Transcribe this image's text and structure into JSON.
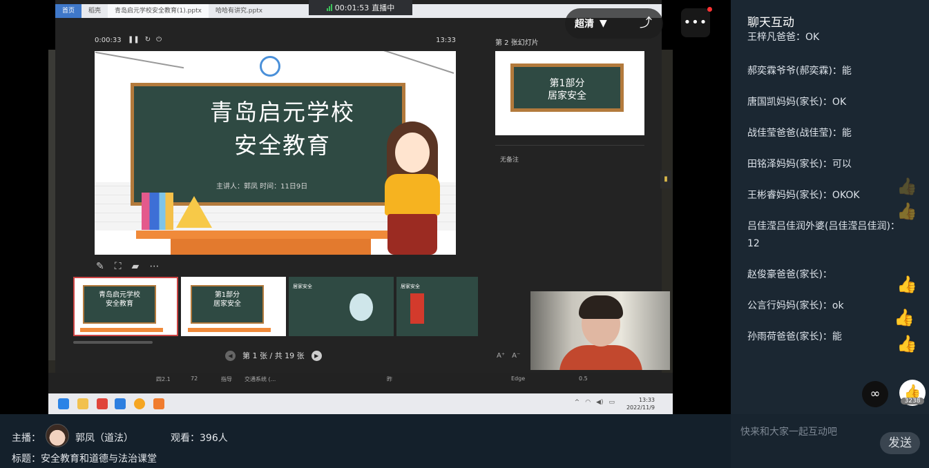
{
  "live": {
    "timer": "00:01:53",
    "status": "直播中"
  },
  "ppt_tabs": [
    "首页",
    "稻壳",
    "青岛启元学校安全教育(1).pptx",
    "哈哈有讲究.pptx"
  ],
  "presenter": {
    "elapsed": "0:00:33",
    "clock": "13:33"
  },
  "slide": {
    "title_line1": "青岛启元学校",
    "title_line2": "安全教育",
    "meta": "主讲人：郭凤    时间：11日9日"
  },
  "thumbs": [
    {
      "label": "青岛启元学校\n安全教育"
    },
    {
      "label": "第1部分\n居家安全"
    },
    {
      "label": "居家安全"
    },
    {
      "label": "居家安全"
    }
  ],
  "pager": {
    "text": "第 1 张 / 共 19 张"
  },
  "next_panel": {
    "title": "第 2 张幻灯片",
    "slide_line1": "第1部分",
    "slide_line2": "居家安全",
    "notes": "无备注"
  },
  "quality": {
    "label": "超清"
  },
  "desktop_bottom": [
    "四2.1",
    "72",
    "指导",
    "交通系统 (...",
    "昨",
    "Edge",
    "0.5"
  ],
  "taskbar_clock": {
    "time": "13:33",
    "date": "2022/11/9"
  },
  "chat": {
    "title": "聊天互动",
    "messages": [
      "王梓凡爸爸：OK",
      "郝奕霖爷爷(郝奕霖)：能",
      "唐国凯妈妈(家长)：OK",
      "战佳莹爸爸(战佳莹)：能",
      "田铭泽妈妈(家长)：可以",
      "王彬睿妈妈(家长)：OKOK",
      "吕佳滢吕佳润外婆(吕佳滢吕佳润)：\n12",
      "赵俊豪爸爸(家长)：",
      "公言行妈妈(家长)：ok",
      "孙雨荷爸爸(家长)：能"
    ],
    "like_count": "3238",
    "input_placeholder": "快来和大家一起互动吧",
    "send_label": "发送"
  },
  "info": {
    "host_label": "主播：",
    "host_name": "郭凤（道法）",
    "viewers": "观看：396人",
    "title_label": "标题：",
    "title": "安全教育和道德与法治课堂"
  }
}
